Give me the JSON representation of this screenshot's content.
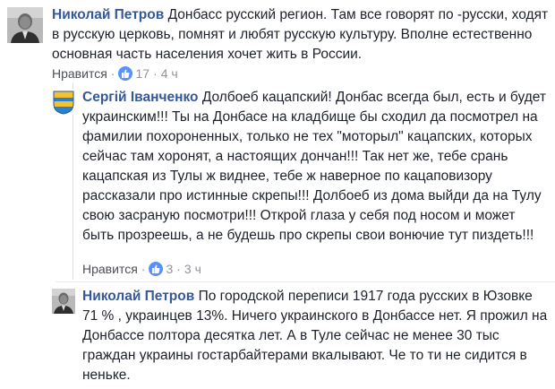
{
  "comments": [
    {
      "author": "Николай Петров",
      "text": "Донбасс русский регион. Там все говорят по -русски, ходят в русскую церковь, помнят и любят русскую культуру. Вполне естественно основная часть населения хочет жить в России.",
      "like_label": "Нравится",
      "likes": "17",
      "time": "4 ч",
      "avatar_icon": "person-photo-icon"
    },
    {
      "author": "Сергій Іванченко",
      "text": "Долбоеб кацапский! Донбас всегда был, есть и будет украинским!!! Ты на Донбасе на кладбище бы сходил да посмотрел на фамилии похороненных, только не тех \"моторыл\" кацапских, которых сейчас там хоронят, а настоящих дончан!!! Так нет же, тебе срань кацапская из Тулы ж виднее, тебе ж наверное по кацаповизору рассказали про истинные скрепы!!! Долбоеб из дома выйди да на Тулу свою засраную посмотри!!! Открой глаза у себя под носом и может быть прозреешь, а не будешь про скрепы свои вонючие тут пиздеть!!!",
      "like_label": "Нравится",
      "likes": "3",
      "time": "3 ч",
      "avatar_icon": "coat-of-arms-icon"
    },
    {
      "author": "Николай Петров",
      "text": "По городской переписи 1917 года русских в Юзовке 71 % , украинцев 13%. Ничего украинского в Донбассе нет. Я прожил на Донбассе полтора десятка лет. А в Туле сейчас не менее 30 тыс граждан украины гостарбайтерами вкалывают. Че то ти не сидится в неньке.",
      "avatar_icon": "person-photo-icon"
    }
  ],
  "colors": {
    "author": "#365899",
    "text": "#1d2129",
    "meta": "#90949c",
    "like_badge": "#5890ff"
  }
}
